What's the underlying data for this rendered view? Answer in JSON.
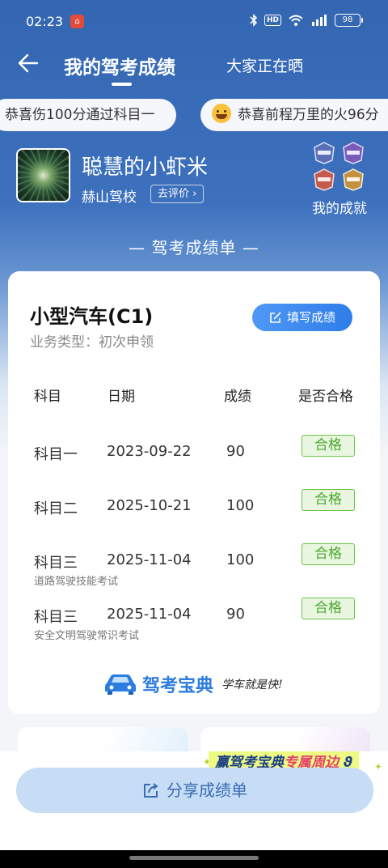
{
  "status_bar": {
    "time": "02:23",
    "battery": "98",
    "hd": "HD"
  },
  "header": {
    "tab_mine": "我的驾考成绩",
    "tab_others": "大家正在晒"
  },
  "marquee": [
    "恭喜伤100分通过科目一",
    "恭喜前程万里的火96分"
  ],
  "profile": {
    "nickname": "聪慧的小虾米",
    "school": "赫山驾校",
    "review_label": "去评价",
    "achievements_label": "我的成就"
  },
  "report_title": "— 驾考成绩单 —",
  "card": {
    "license": "小型汽车(C1)",
    "business_type": "业务类型：初次申领",
    "fill_button": "填写成绩",
    "columns": [
      "科目",
      "日期",
      "成绩",
      "是否合格"
    ],
    "rows": [
      {
        "subject": "科目一",
        "date": "2023-09-22",
        "score": "90",
        "result": "合格",
        "note": ""
      },
      {
        "subject": "科目二",
        "date": "2025-10-21",
        "score": "100",
        "result": "合格",
        "note": ""
      },
      {
        "subject": "科目三",
        "date": "2025-11-04",
        "score": "100",
        "result": "合格",
        "note": "道路驾驶技能考试"
      },
      {
        "subject": "科目三",
        "date": "2025-11-04",
        "score": "90",
        "result": "合格",
        "note": "安全文明驾驶常识考试"
      }
    ],
    "brand_name": "驾考宝典",
    "brand_slogan": "学车就是快!"
  },
  "promo": {
    "prefix": "赢驾考宝典",
    "accent": "专属周边"
  },
  "share_button": "分享成绩单",
  "colors": {
    "header_blue": "#3466b2",
    "accent_blue": "#2f7de9",
    "pass_green": "#4aa82e"
  }
}
